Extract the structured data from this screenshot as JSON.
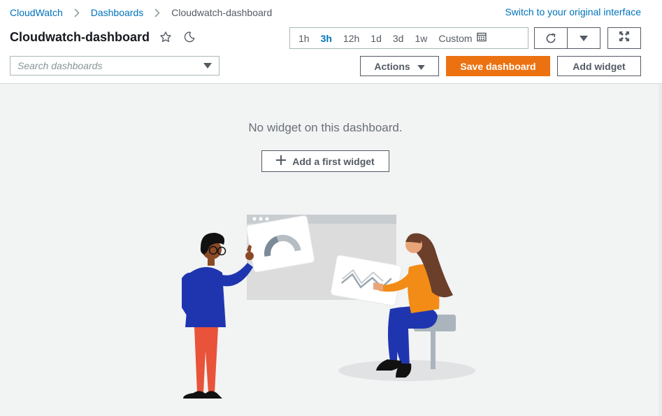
{
  "breadcrumb": {
    "items": [
      "CloudWatch",
      "Dashboards"
    ],
    "current": "Cloudwatch-dashboard"
  },
  "switch_link": "Switch to your original interface",
  "title": "Cloudwatch-dashboard",
  "icons": {
    "favorite": "star-icon",
    "theme": "moon-icon",
    "separator": "chevron-right-icon",
    "calendar": "calendar-icon",
    "refresh": "refresh-icon",
    "refresh_menu": "caret-down-icon",
    "fullscreen": "fullscreen-icon",
    "search_dropdown": "caret-down-icon",
    "add": "plus-icon"
  },
  "time_range": {
    "options": [
      "1h",
      "3h",
      "12h",
      "1d",
      "3d",
      "1w"
    ],
    "selected": "3h",
    "custom_label": "Custom"
  },
  "search": {
    "placeholder": "Search dashboards",
    "value": ""
  },
  "toolbar": {
    "actions_label": "Actions",
    "save_label": "Save dashboard",
    "add_widget_label": "Add widget"
  },
  "empty_state": {
    "message": "No widget on this dashboard.",
    "add_first_label": "Add a first widget"
  },
  "colors": {
    "accent": "#0073bb",
    "primary_button": "#ec7211",
    "background": "#f2f3f3"
  }
}
